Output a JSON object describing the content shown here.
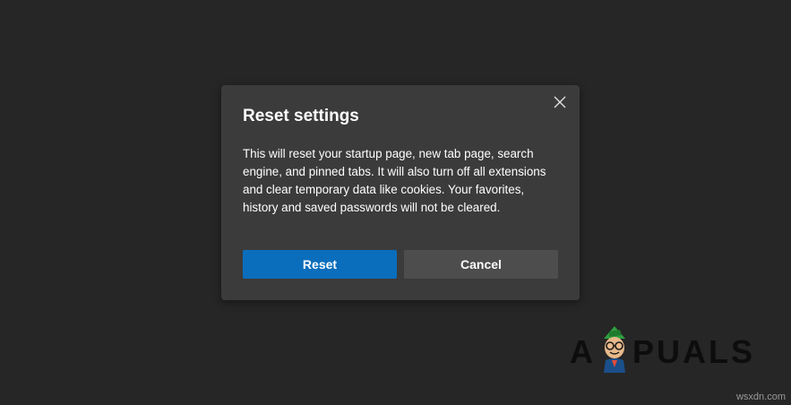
{
  "dialog": {
    "title": "Reset settings",
    "body": "This will reset your startup page, new tab page, search engine, and pinned tabs. It will also turn off all extensions and clear temporary data like cookies. Your favorites, history and saved passwords will not be cleared.",
    "reset_label": "Reset",
    "cancel_label": "Cancel",
    "close_icon": "close-icon"
  },
  "watermark": {
    "brand_first": "A",
    "brand_rest": "PUALS",
    "site": "wsxdn.com"
  },
  "colors": {
    "background": "#262626",
    "dialog": "#3b3b3b",
    "primary_button": "#0a6ebd",
    "secondary_button": "#4d4d4d",
    "text": "#ffffff"
  }
}
